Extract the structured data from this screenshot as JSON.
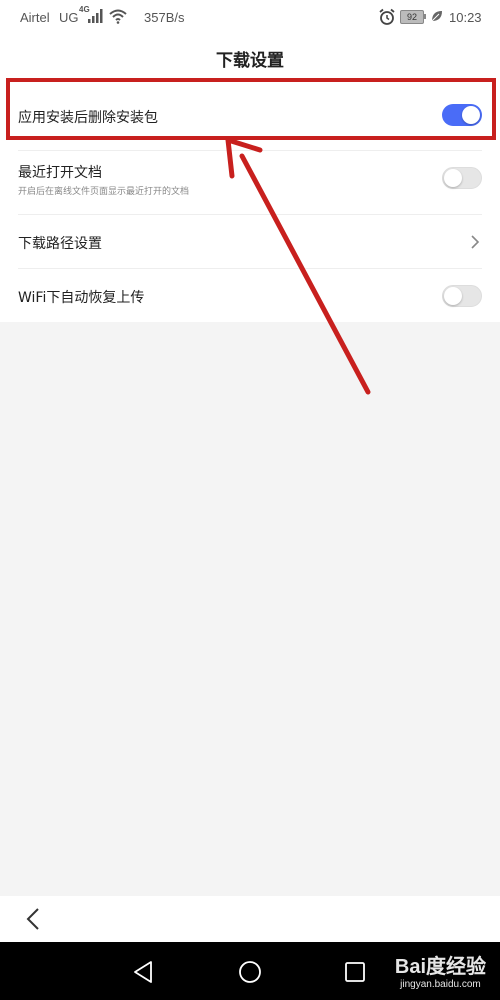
{
  "status_bar": {
    "carrier": "Airtel",
    "network": "UG",
    "network_generation": "4G",
    "speed": "357B/s",
    "battery": "92",
    "time": "10:23"
  },
  "header": {
    "title": "下载设置"
  },
  "settings": [
    {
      "label": "应用安装后删除安装包",
      "toggle": "on"
    },
    {
      "label": "最近打开文档",
      "description": "开启后在离线文件页面显示最近打开的文档",
      "toggle": "off"
    },
    {
      "label": "下载路径设置",
      "control": "chevron-right-icon"
    },
    {
      "label": "WiFi下自动恢复上传",
      "toggle": "off"
    }
  ],
  "annotation": {
    "color": "#c8201e"
  },
  "bottom_bar": {
    "back_icon": "chevron-left-icon"
  },
  "nav_bar": {
    "icons": [
      "triangle-back-icon",
      "circle-home-icon",
      "square-recent-icon"
    ]
  },
  "watermark": {
    "brand": "Bai度经验",
    "site": "jingyan.baidu.com"
  },
  "colors": {
    "accent": "#4a6cf7",
    "toggle_off": "#e6e6e6",
    "background": "#f4f4f4"
  }
}
